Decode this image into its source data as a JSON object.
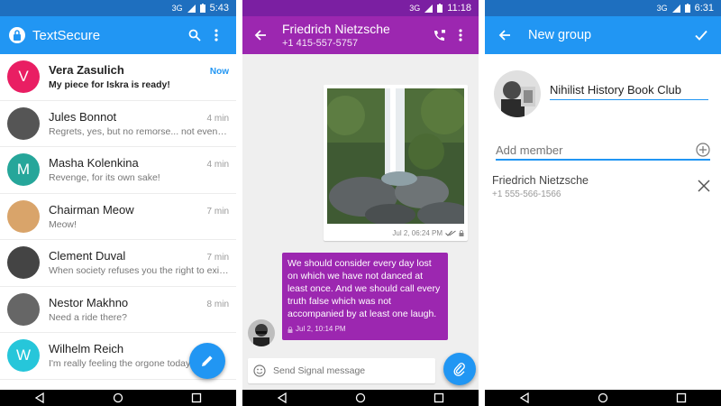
{
  "colors": {
    "blue": "#2196f3",
    "blue_dark": "#1e6fbf",
    "purple": "#9c27b0",
    "purple_dark": "#7b1fa2"
  },
  "screen1": {
    "status": {
      "network": "3G",
      "time": "5:43"
    },
    "app_title": "TextSecure",
    "toolbar_icons": [
      "search-icon",
      "more-vert-icon"
    ],
    "conversations": [
      {
        "name": "Vera Zasulich",
        "time": "Now",
        "snippet": "My piece for Iskra is ready!",
        "avatar_letter": "V",
        "avatar_color": "#e91e63",
        "unread": true
      },
      {
        "name": "Jules Bonnot",
        "time": "4 min",
        "snippet": "Regrets, yes, but no remorse... not even a gli",
        "avatar_letter": "",
        "avatar_color": "#555555",
        "unread": false
      },
      {
        "name": "Masha Kolenkina",
        "time": "4 min",
        "snippet": "Revenge, for its own sake!",
        "avatar_letter": "M",
        "avatar_color": "#26a69a",
        "unread": false
      },
      {
        "name": "Chairman Meow",
        "time": "7 min",
        "snippet": "Meow!",
        "avatar_letter": "",
        "avatar_color": "#d9a46a",
        "unread": false
      },
      {
        "name": "Clement Duval",
        "time": "7 min",
        "snippet": "When society refuses you the right to exist,...",
        "avatar_letter": "",
        "avatar_color": "#444444",
        "unread": false
      },
      {
        "name": "Nestor Makhno",
        "time": "8 min",
        "snippet": "Need a ride there?",
        "avatar_letter": "",
        "avatar_color": "#666666",
        "unread": false
      },
      {
        "name": "Wilhelm Reich",
        "time": "",
        "snippet": "I'm really feeling the orgone today!",
        "avatar_letter": "W",
        "avatar_color": "#26c6da",
        "unread": false
      }
    ]
  },
  "screen2": {
    "status": {
      "network": "3G",
      "time": "11:18"
    },
    "contact_name": "Friedrich Nietzsche",
    "contact_number": "+1 415-557-5757",
    "image_message": {
      "timestamp": "Jul 2, 06:24 PM"
    },
    "text_message": {
      "text": "We should consider every day lost on which we have not danced at least once. And we should call every truth false which was not accompanied by at least one laugh.",
      "timestamp": "Jul 2, 10:14 PM"
    },
    "compose_placeholder": "Send Signal message"
  },
  "screen3": {
    "status": {
      "network": "3G",
      "time": "6:31"
    },
    "title": "New group",
    "group_name": "Nihilist History Book Club",
    "add_member_placeholder": "Add member",
    "members": [
      {
        "name": "Friedrich Nietzsche",
        "number": "+1 555-566-1566"
      }
    ]
  }
}
